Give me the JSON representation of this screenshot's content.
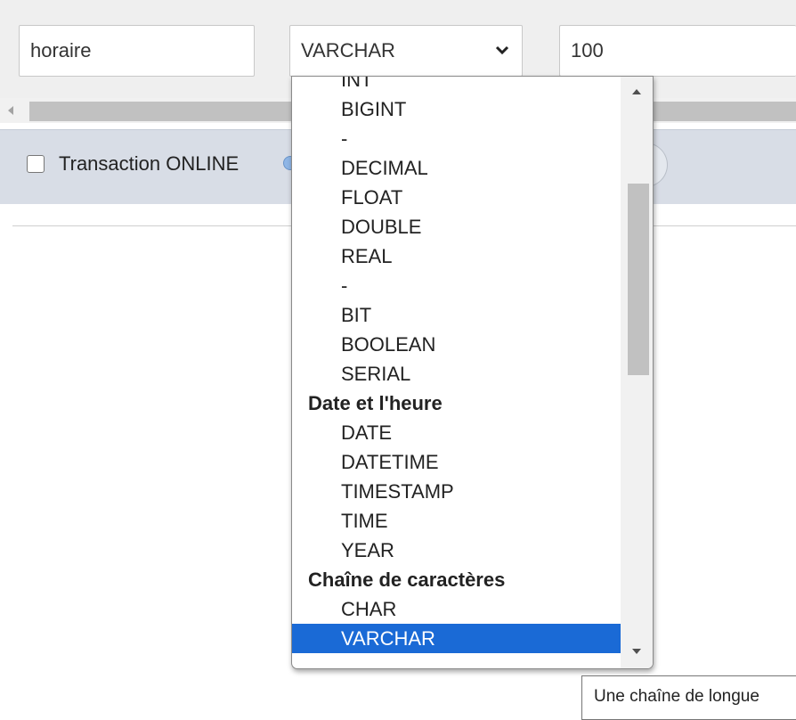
{
  "fields": {
    "name_value": "horaire",
    "type_value": "VARCHAR",
    "length_value": "100"
  },
  "transaction": {
    "label": "Transaction ONLINE",
    "checked": false
  },
  "dropdown": {
    "options": [
      {
        "label": "INT",
        "kind": "option"
      },
      {
        "label": "BIGINT",
        "kind": "option"
      },
      {
        "label": "-",
        "kind": "option"
      },
      {
        "label": "DECIMAL",
        "kind": "option"
      },
      {
        "label": "FLOAT",
        "kind": "option"
      },
      {
        "label": "DOUBLE",
        "kind": "option"
      },
      {
        "label": "REAL",
        "kind": "option"
      },
      {
        "label": "-",
        "kind": "option"
      },
      {
        "label": "BIT",
        "kind": "option"
      },
      {
        "label": "BOOLEAN",
        "kind": "option"
      },
      {
        "label": "SERIAL",
        "kind": "option"
      },
      {
        "label": "Date et l'heure",
        "kind": "group"
      },
      {
        "label": "DATE",
        "kind": "option"
      },
      {
        "label": "DATETIME",
        "kind": "option"
      },
      {
        "label": "TIMESTAMP",
        "kind": "option"
      },
      {
        "label": "TIME",
        "kind": "option"
      },
      {
        "label": "YEAR",
        "kind": "option"
      },
      {
        "label": "Chaîne de caractères",
        "kind": "group"
      },
      {
        "label": "CHAR",
        "kind": "option"
      },
      {
        "label": "VARCHAR",
        "kind": "option",
        "selected": true
      }
    ],
    "selected_color": "#1a6ad6"
  },
  "tooltip": {
    "text": "Une chaîne de longue"
  },
  "icons": {
    "select_arrow": "chevron-down-icon",
    "help": "info-icon",
    "scroll_up": "scroll-up-arrow-icon",
    "scroll_down": "scroll-down-arrow-icon",
    "scroll_left": "scroll-left-arrow-icon"
  }
}
